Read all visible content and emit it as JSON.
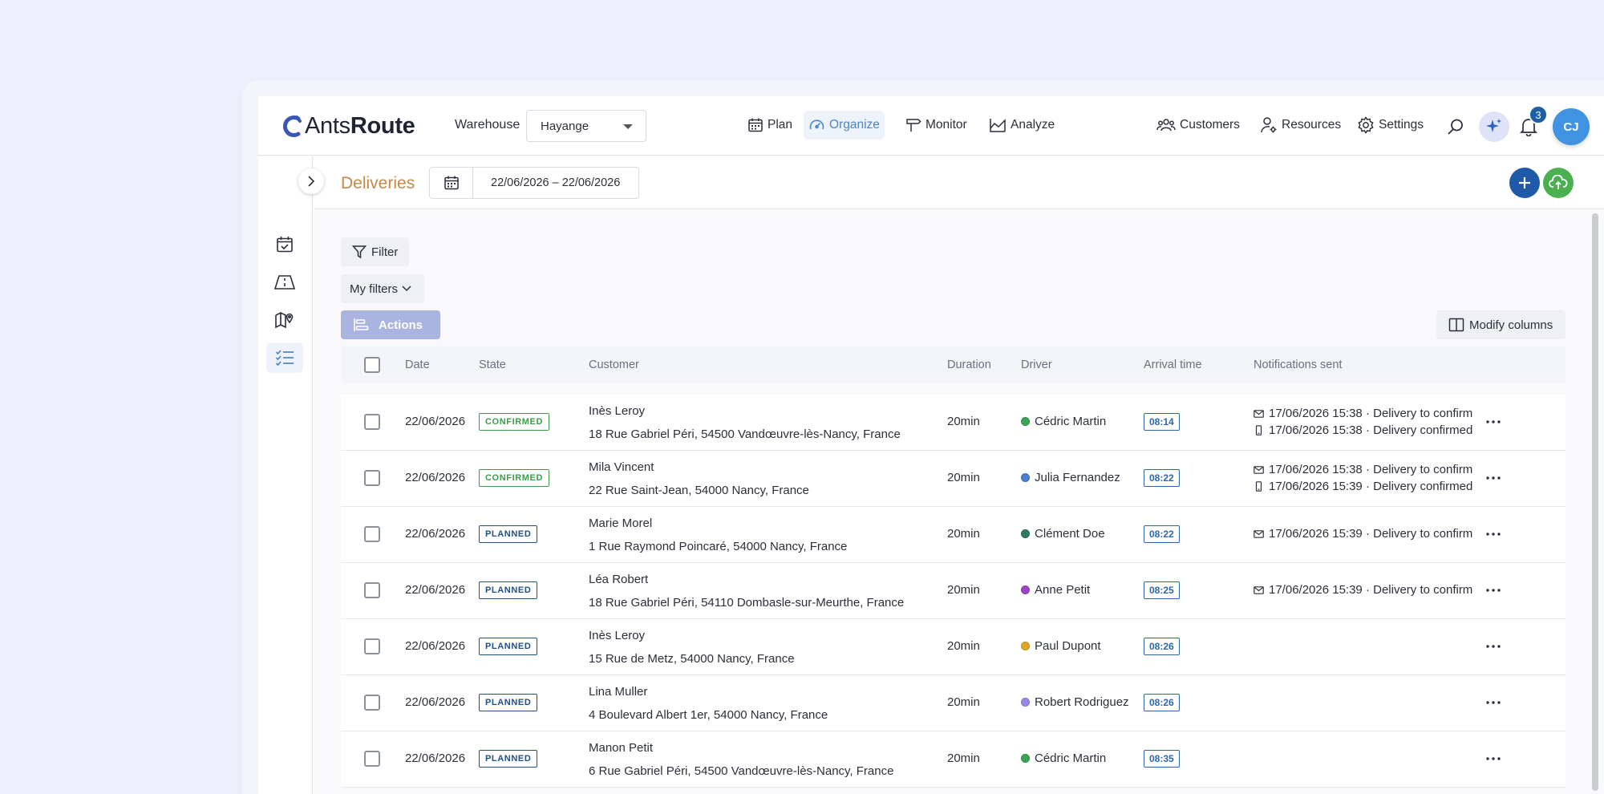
{
  "app": {
    "logo_light": "Ants",
    "logo_bold": "Route"
  },
  "header": {
    "warehouse_label": "Warehouse",
    "warehouse_value": "Hayange",
    "nav": [
      {
        "label": "Plan",
        "icon": "calendar-icon"
      },
      {
        "label": "Organize",
        "icon": "gauge-icon",
        "active": true
      },
      {
        "label": "Monitor",
        "icon": "signpost-icon"
      },
      {
        "label": "Analyze",
        "icon": "chart-area-icon"
      }
    ],
    "right_nav": [
      {
        "label": "Customers",
        "icon": "users-icon"
      },
      {
        "label": "Resources",
        "icon": "user-gear-icon"
      },
      {
        "label": "Settings",
        "icon": "gear-icon"
      }
    ],
    "notification_count": "3",
    "avatar_initials": "CJ",
    "accent_color": "#4a86c8"
  },
  "sidebar": {
    "items": [
      "calendar-check-icon",
      "road-icon",
      "map-pin-icon",
      "list-check-icon"
    ],
    "active_index": 3
  },
  "subheader": {
    "title": "Deliveries",
    "date_range": "22/06/2026 – 22/06/2026"
  },
  "toolbar": {
    "filter_label": "Filter",
    "my_filters_label": "My filters",
    "actions_label": "Actions",
    "modify_columns_label": "Modify columns"
  },
  "table": {
    "headers": {
      "date": "Date",
      "state": "State",
      "customer": "Customer",
      "duration": "Duration",
      "driver": "Driver",
      "arrival": "Arrival time",
      "notifications": "Notifications sent"
    },
    "rows": [
      {
        "date": "22/06/2026",
        "state": "CONFIRMED",
        "customer_name": "Inès Leroy",
        "address": "18 Rue Gabriel Péri, 54500 Vandœuvre-lès-Nancy, France",
        "duration": "20min",
        "driver": "Cédric Martin",
        "driver_color": "#3aa655",
        "arrival": "08:14",
        "notifications": [
          {
            "type": "email",
            "text": "17/06/2026 15:38 · Delivery to confirm"
          },
          {
            "type": "sms",
            "text": "17/06/2026 15:38 · Delivery confirmed"
          }
        ]
      },
      {
        "date": "22/06/2026",
        "state": "CONFIRMED",
        "customer_name": "Mila Vincent",
        "address": "22 Rue Saint-Jean, 54000 Nancy, France",
        "duration": "20min",
        "driver": "Julia Fernandez",
        "driver_color": "#4a7fd4",
        "arrival": "08:22",
        "notifications": [
          {
            "type": "email",
            "text": "17/06/2026 15:38 · Delivery to confirm"
          },
          {
            "type": "sms",
            "text": "17/06/2026 15:39 · Delivery confirmed"
          }
        ]
      },
      {
        "date": "22/06/2026",
        "state": "PLANNED",
        "customer_name": "Marie Morel",
        "address": "1 Rue Raymond Poincaré, 54000 Nancy, France",
        "duration": "20min",
        "driver": "Clément Doe",
        "driver_color": "#2f7a66",
        "arrival": "08:22",
        "notifications": [
          {
            "type": "email",
            "text": "17/06/2026 15:39 · Delivery to confirm"
          }
        ]
      },
      {
        "date": "22/06/2026",
        "state": "PLANNED",
        "customer_name": "Léa Robert",
        "address": "18 Rue Gabriel Péri, 54110 Dombasle-sur-Meurthe, France",
        "duration": "20min",
        "driver": "Anne Petit",
        "driver_color": "#9b45c8",
        "arrival": "08:25",
        "notifications": [
          {
            "type": "email",
            "text": "17/06/2026 15:39 · Delivery to confirm"
          }
        ]
      },
      {
        "date": "22/06/2026",
        "state": "PLANNED",
        "customer_name": "Inès Leroy",
        "address": "15 Rue de Metz, 54000 Nancy, France",
        "duration": "20min",
        "driver": "Paul Dupont",
        "driver_color": "#e0a526",
        "arrival": "08:26",
        "notifications": []
      },
      {
        "date": "22/06/2026",
        "state": "PLANNED",
        "customer_name": "Lina Muller",
        "address": "4 Boulevard Albert 1er, 54000 Nancy, France",
        "duration": "20min",
        "driver": "Robert Rodriguez",
        "driver_color": "#9a86e6",
        "arrival": "08:26",
        "notifications": []
      },
      {
        "date": "22/06/2026",
        "state": "PLANNED",
        "customer_name": "Manon Petit",
        "address": "6 Rue Gabriel Péri, 54500 Vandœuvre-lès-Nancy, France",
        "duration": "20min",
        "driver": "Cédric Martin",
        "driver_color": "#3aa655",
        "arrival": "08:35",
        "notifications": []
      }
    ]
  }
}
